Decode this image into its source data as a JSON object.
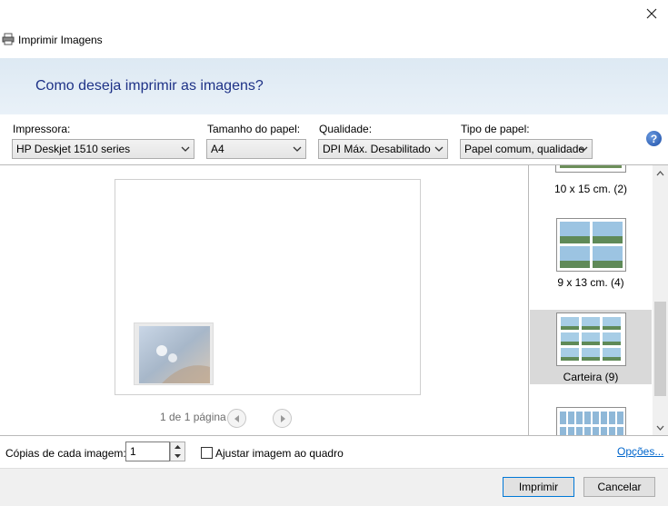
{
  "window": {
    "title": "Imprimir Imagens",
    "close_icon": "close-icon"
  },
  "banner": {
    "heading": "Como deseja imprimir as imagens?"
  },
  "options": {
    "printer": {
      "label": "Impressora:",
      "value": "HP Deskjet 1510 series"
    },
    "paper_size": {
      "label": "Tamanho do papel:",
      "value": "A4"
    },
    "quality": {
      "label": "Qualidade:",
      "value": "DPI Máx. Desabilitado"
    },
    "paper_type": {
      "label": "Tipo de papel:",
      "value": "Papel comum, qualidade"
    },
    "help": "?"
  },
  "preview": {
    "page_counter": "1 de 1 página"
  },
  "layouts": [
    {
      "label": "10 x 15 cm. (2)",
      "selected": false
    },
    {
      "label": "9 x 13 cm. (4)",
      "selected": false
    },
    {
      "label": "Carteira (9)",
      "selected": true
    },
    {
      "label": "",
      "selected": false
    }
  ],
  "bottom": {
    "copies_label": "Cópias de cada imagem:",
    "copies_value": "1",
    "fit_label": "Ajustar imagem ao quadro",
    "fit_checked": false,
    "options_link": "Opções..."
  },
  "footer": {
    "print_button": "Imprimir",
    "cancel_button": "Cancelar"
  },
  "colors": {
    "banner_text": "#1e3287",
    "link": "#0066cc",
    "selected_layout": "#d9d9d9"
  }
}
